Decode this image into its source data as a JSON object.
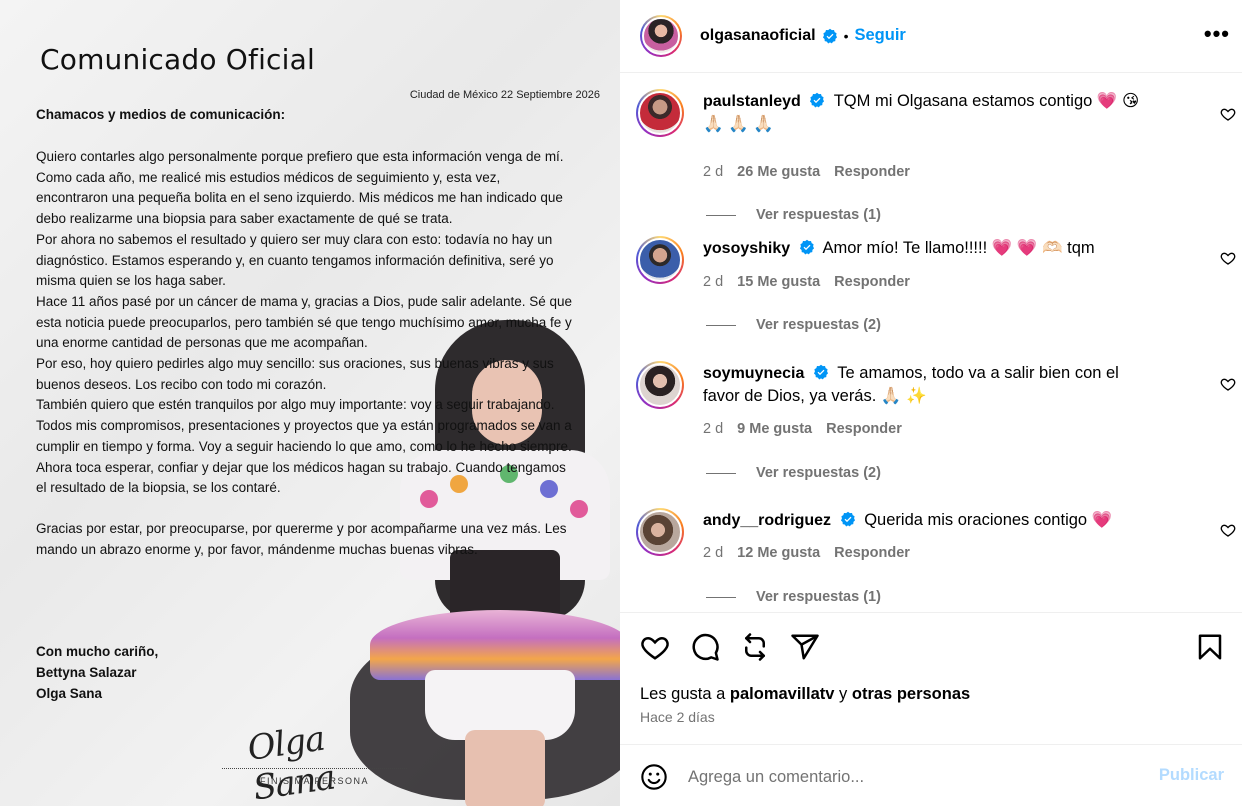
{
  "post": {
    "document": {
      "title": "Comunicado Oficial",
      "date": "Ciudad de México 22 Septiembre 2026",
      "greeting": "Chamacos y medios de comunicación:",
      "paragraphs": [
        "Quiero contarles algo personalmente porque prefiero que esta información venga de mí.",
        "Como cada año, me realicé mis estudios médicos de seguimiento y, esta vez, encontraron una pequeña bolita en el seno izquierdo. Mis médicos me han indicado que debo realizarme una biopsia para saber exactamente de qué se trata.",
        "Por ahora no sabemos el resultado y quiero ser muy clara con esto: todavía no hay un diagnóstico. Estamos esperando y, en cuanto tengamos información definitiva, seré yo misma quien se los haga saber.",
        "Hace 11 años pasé por un cáncer de mama y, gracias a Dios, pude salir adelante. Sé que esta noticia puede preocuparlos, pero también sé que tengo muchísimo amor, mucha fe y una enorme cantidad de personas que me acompañan.",
        "Por eso, hoy quiero pedirles algo muy sencillo: sus oraciones, sus buenas vibras y sus buenos deseos. Los recibo con todo mi corazón.",
        "También quiero que estén tranquilos por algo muy importante: voy a seguir trabajando. Todos mis compromisos, presentaciones y proyectos que ya están programados se van a cumplir en tiempo y forma. Voy a seguir haciendo lo que amo, como lo he hecho siempre.",
        "Ahora toca esperar, confiar y dejar que los médicos hagan su trabajo. Cuando tengamos el resultado de la biopsia, se los contaré.",
        "Gracias por estar, por preocuparse, por quererme y por acompañarme una vez más. Les mando un abrazo enorme y, por favor, mándenme muchas buenas vibras."
      ],
      "closing_1": "Con mucho cariño,",
      "closing_2": "Bettyna Salazar",
      "closing_3": "Olga Sana",
      "signature_script": "Olga Sana",
      "signature_caption": "FINISIMA PERSONA"
    }
  },
  "header": {
    "username": "olgasanaoficial",
    "separator": "•",
    "follow_label": "Seguir",
    "more_label": "•••"
  },
  "comments": [
    {
      "username": "paulstanleyd",
      "text": "TQM mi Olgasana estamos contigo 💗 😘 🙏🏻 🙏🏻 🙏🏻",
      "time": "2 d",
      "likes": "26 Me gusta",
      "reply": "Responder",
      "view_replies": "Ver respuestas (1)"
    },
    {
      "username": "yosoyshiky",
      "text": "Amor mío! Te llamo!!!!! 💗 💗 🫶🏻 tqm",
      "time": "2 d",
      "likes": "15 Me gusta",
      "reply": "Responder",
      "view_replies": "Ver respuestas (2)"
    },
    {
      "username": "soymuynecia",
      "text": "Te amamos, todo va a salir bien con el favor de Dios, ya verás. 🙏🏻 ✨",
      "time": "2 d",
      "likes": "9 Me gusta",
      "reply": "Responder",
      "view_replies": "Ver respuestas (2)"
    },
    {
      "username": "andy__rodriguez",
      "text": "Querida mis oraciones contigo 💗",
      "time": "2 d",
      "likes": "12 Me gusta",
      "reply": "Responder",
      "view_replies": "Ver respuestas (1)"
    }
  ],
  "footer": {
    "likes_prefix": "Les gusta a",
    "likes_user": "palomavillatv",
    "likes_and": "y",
    "likes_others": "otras personas",
    "time_ago": "Hace 2 días",
    "comment_placeholder": "Agrega un comentario...",
    "publish_label": "Publicar"
  },
  "colors": {
    "accent": "#0095f6",
    "publish_disabled": "#b3dbff",
    "secondary_text": "#737373",
    "verified": "#0095f6"
  },
  "icons": [
    "verified-badge-icon",
    "more-options-icon",
    "heart-icon",
    "comment-icon",
    "repost-icon",
    "share-icon",
    "bookmark-icon",
    "emoji-icon"
  ]
}
